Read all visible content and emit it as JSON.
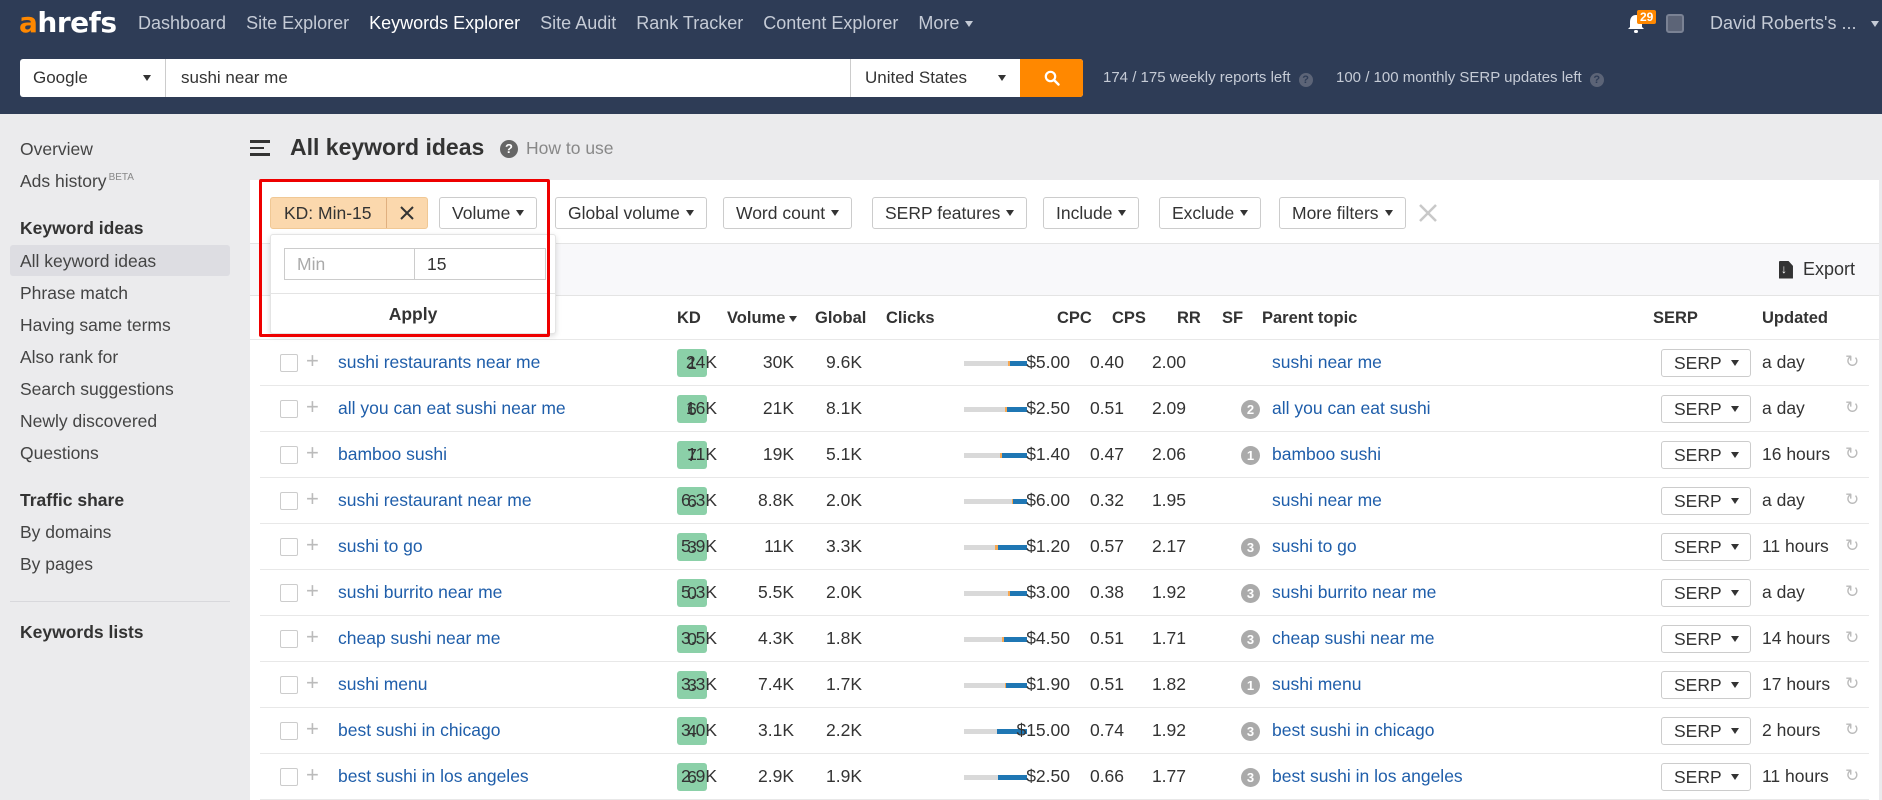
{
  "header": {
    "logo": {
      "accent": "a",
      "rest": "hrefs"
    },
    "nav": [
      {
        "label": "Dashboard",
        "active": false
      },
      {
        "label": "Site Explorer",
        "active": false
      },
      {
        "label": "Keywords Explorer",
        "active": true
      },
      {
        "label": "Site Audit",
        "active": false
      },
      {
        "label": "Rank Tracker",
        "active": false
      },
      {
        "label": "Content Explorer",
        "active": false
      },
      {
        "label": "More",
        "active": false
      }
    ],
    "notifications_count": "29",
    "user": "David Roberts's ..."
  },
  "search": {
    "engine": "Google",
    "query": "sushi near me",
    "country": "United States",
    "weekly_quota": "174 / 175 weekly reports left",
    "monthly_quota": "100 / 100 monthly SERP updates left"
  },
  "sidebar": {
    "overview": "Overview",
    "ads_history": "Ads history",
    "ads_history_badge": "BETA",
    "keyword_ideas_heading": "Keyword ideas",
    "keyword_ideas": [
      "All keyword ideas",
      "Phrase match",
      "Having same terms",
      "Also rank for",
      "Search suggestions",
      "Newly discovered",
      "Questions"
    ],
    "active_item": "All keyword ideas",
    "traffic_share_heading": "Traffic share",
    "traffic_share": [
      "By domains",
      "By pages"
    ],
    "keywords_lists_heading": "Keywords lists"
  },
  "main": {
    "title": "All keyword ideas",
    "how_to_use": "How to use",
    "filters": {
      "kd_chip": "KD: Min-15",
      "buttons": [
        "Volume",
        "Global volume",
        "Word count",
        "SERP features",
        "Include",
        "Exclude",
        "More filters"
      ]
    },
    "kd_popup": {
      "min_placeholder": "Min",
      "min_value": "",
      "max_value": "15",
      "apply_label": "Apply"
    },
    "export_label": "Export",
    "columns": [
      "KD",
      "Volume",
      "Global",
      "Clicks",
      "CPC",
      "CPS",
      "RR",
      "SF",
      "Parent topic",
      "SERP",
      "Updated"
    ],
    "sort_column": "Volume",
    "serp_button_label": "SERP",
    "rows": [
      {
        "keyword": "sushi restaurants near me",
        "kd": "1",
        "volume": "24K",
        "global": "30K",
        "clicks": "9.6K",
        "click_split": {
          "no_click": 0.7,
          "paid": 0.03,
          "organic": 0.27
        },
        "cpc": "$5.00",
        "cps": "0.40",
        "rr": "2.00",
        "sf": "",
        "parent": "sushi near me",
        "updated": "a day"
      },
      {
        "keyword": "all you can eat sushi near me",
        "kd": "6",
        "volume": "16K",
        "global": "21K",
        "clicks": "8.1K",
        "click_split": {
          "no_click": 0.65,
          "paid": 0.03,
          "organic": 0.32
        },
        "cpc": "$2.50",
        "cps": "0.51",
        "rr": "2.09",
        "sf": "2",
        "parent": "all you can eat sushi",
        "updated": "a day"
      },
      {
        "keyword": "bamboo sushi",
        "kd": "7",
        "volume": "11K",
        "global": "19K",
        "clicks": "5.1K",
        "click_split": {
          "no_click": 0.57,
          "paid": 0.03,
          "organic": 0.4
        },
        "cpc": "$1.40",
        "cps": "0.47",
        "rr": "2.06",
        "sf": "1",
        "parent": "bamboo sushi",
        "updated": "16 hours"
      },
      {
        "keyword": "sushi restaurant near me",
        "kd": "6",
        "volume": "6.3K",
        "global": "8.8K",
        "clicks": "2.0K",
        "click_split": {
          "no_click": 0.76,
          "paid": 0.01,
          "organic": 0.23
        },
        "cpc": "$6.00",
        "cps": "0.32",
        "rr": "1.95",
        "sf": "",
        "parent": "sushi near me",
        "updated": "a day"
      },
      {
        "keyword": "sushi to go",
        "kd": "3",
        "volume": "5.9K",
        "global": "11K",
        "clicks": "3.3K",
        "click_split": {
          "no_click": 0.49,
          "paid": 0.05,
          "organic": 0.46
        },
        "cpc": "$1.20",
        "cps": "0.57",
        "rr": "2.17",
        "sf": "3",
        "parent": "sushi to go",
        "updated": "11 hours"
      },
      {
        "keyword": "sushi burrito near me",
        "kd": "0",
        "volume": "5.3K",
        "global": "5.5K",
        "clicks": "2.0K",
        "click_split": {
          "no_click": 0.7,
          "paid": 0.03,
          "organic": 0.27
        },
        "cpc": "$3.00",
        "cps": "0.38",
        "rr": "1.92",
        "sf": "3",
        "parent": "sushi burrito near me",
        "updated": "a day"
      },
      {
        "keyword": "cheap sushi near me",
        "kd": "0",
        "volume": "3.5K",
        "global": "4.3K",
        "clicks": "1.8K",
        "click_split": {
          "no_click": 0.6,
          "paid": 0.03,
          "organic": 0.37
        },
        "cpc": "$4.50",
        "cps": "0.51",
        "rr": "1.71",
        "sf": "3",
        "parent": "cheap sushi near me",
        "updated": "14 hours"
      },
      {
        "keyword": "sushi menu",
        "kd": "3",
        "volume": "3.3K",
        "global": "7.4K",
        "clicks": "1.7K",
        "click_split": {
          "no_click": 0.65,
          "paid": 0.02,
          "organic": 0.33
        },
        "cpc": "$1.90",
        "cps": "0.51",
        "rr": "1.82",
        "sf": "1",
        "parent": "sushi menu",
        "updated": "17 hours"
      },
      {
        "keyword": "best sushi in chicago",
        "kd": "4",
        "volume": "3.0K",
        "global": "3.1K",
        "clicks": "2.2K",
        "click_split": {
          "no_click": 0.52,
          "paid": 0.0,
          "organic": 0.48
        },
        "cpc": "$15.00",
        "cps": "0.74",
        "rr": "1.92",
        "sf": "3",
        "parent": "best sushi in chicago",
        "updated": "2 hours"
      },
      {
        "keyword": "best sushi in los angeles",
        "kd": "6",
        "volume": "2.9K",
        "global": "2.9K",
        "clicks": "1.9K",
        "click_split": {
          "no_click": 0.54,
          "paid": 0.0,
          "organic": 0.46
        },
        "cpc": "$2.50",
        "cps": "0.66",
        "rr": "1.77",
        "sf": "3",
        "parent": "best sushi in los angeles",
        "updated": "11 hours"
      }
    ]
  },
  "colors": {
    "header_bg": "#2e3c56",
    "brand_orange": "#ff8800",
    "link_blue": "#1f5eaa",
    "kd_green": "#8bd0a8",
    "highlight_red": "#ee0000",
    "organic_blue": "#1f77b4",
    "paid_orange": "#f5a853",
    "no_click_gray": "#d9d9d9"
  }
}
